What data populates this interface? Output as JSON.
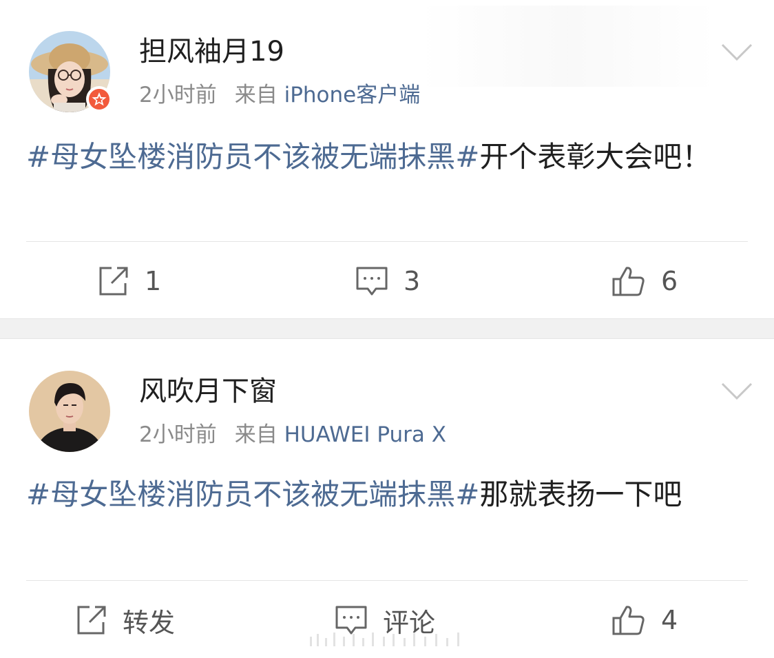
{
  "posts": [
    {
      "username": "担风袖月19",
      "time": "2小时前",
      "source_prefix": "来自",
      "device": "iPhone客户端",
      "hashtag": "#母女坠楼消防员不该被无端抹黑#",
      "body": "开个表彰大会吧！",
      "actions": {
        "repost": "1",
        "comment": "3",
        "like": "6"
      },
      "badge_icon": "verified-star-icon",
      "accent_color": "#4d6a92"
    },
    {
      "username": "风吹月下窗",
      "time": "2小时前",
      "source_prefix": "来自",
      "device": "HUAWEI Pura X",
      "hashtag": "#母女坠楼消防员不该被无端抹黑#",
      "body": "那就表扬一下吧",
      "actions": {
        "repost": "转发",
        "comment": "评论",
        "like": "4"
      },
      "accent_color": "#4d6a92"
    }
  ],
  "icons": {
    "repost": "repost-icon",
    "comment": "comment-icon",
    "like": "thumbs-up-icon",
    "menu": "chevron-down-icon"
  }
}
